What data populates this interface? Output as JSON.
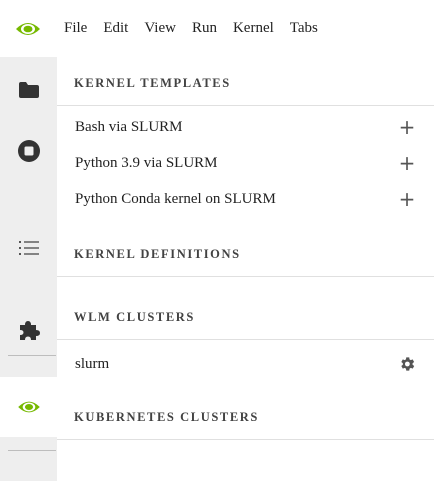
{
  "menubar": {
    "logo_icon": "nvidia-eye-icon",
    "items": [
      {
        "label": "File"
      },
      {
        "label": "Edit"
      },
      {
        "label": "View"
      },
      {
        "label": "Run"
      },
      {
        "label": "Kernel"
      },
      {
        "label": "Tabs"
      }
    ]
  },
  "activity_bar": {
    "icons": [
      "folder-icon",
      "running-stop-icon",
      "table-of-contents-icon",
      "extension-puzzle-icon",
      "nvidia-eye-icon"
    ]
  },
  "panel": {
    "kernel_templates": {
      "title": "KERNEL TEMPLATES",
      "items": [
        {
          "label": "Bash via SLURM",
          "action": "+"
        },
        {
          "label": "Python 3.9 via SLURM",
          "action": "+"
        },
        {
          "label": "Python Conda kernel on SLURM",
          "action": "+"
        }
      ]
    },
    "kernel_definitions": {
      "title": "KERNEL DEFINITIONS"
    },
    "wlm_clusters": {
      "title": "WLM CLUSTERS",
      "items": [
        {
          "label": "slurm"
        }
      ]
    },
    "kubernetes_clusters": {
      "title": "KUBERNETES CLUSTERS"
    }
  },
  "colors": {
    "nvidia_green": "#76b900",
    "activity_bg": "#eeeeee",
    "icon_dark": "#333333"
  }
}
